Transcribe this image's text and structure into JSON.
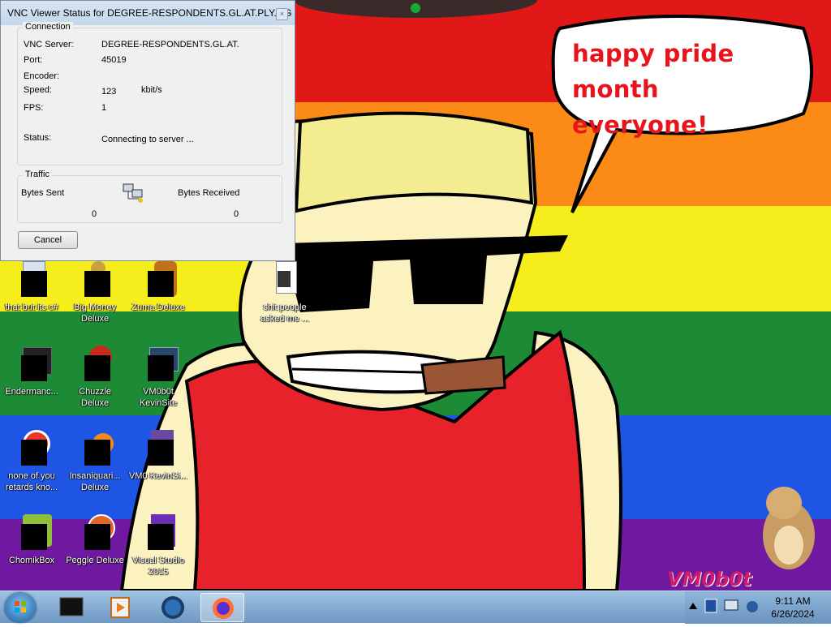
{
  "wallpaper": {
    "bubble_text": "happy pride month everyone!",
    "watermark": "VM0b0t"
  },
  "vnc_dialog": {
    "title": "VNC Viewer Status for DEGREE-RESPONDENTS.GL.AT.PLY.GG",
    "connection_group": "Connection",
    "server_label": "VNC Server:",
    "server_value": "DEGREE-RESPONDENTS.GL.AT.",
    "port_label": "Port:",
    "port_value": "45019",
    "encoder_label": "Encoder:",
    "encoder_value": "",
    "speed_label": "Speed:",
    "speed_value": "123",
    "speed_unit": "kbit/s",
    "fps_label": "FPS:",
    "fps_value": "1",
    "status_label": "Status:",
    "status_value": "Connecting to server ...",
    "traffic_group": "Traffic",
    "bytes_sent_label": "Bytes Sent",
    "bytes_sent_value": "0",
    "bytes_received_label": "Bytes Received",
    "bytes_received_value": "0",
    "cancel_label": "Cancel"
  },
  "desktop_icons": [
    {
      "label": "that but its c#"
    },
    {
      "label": "Big Money Deluxe"
    },
    {
      "label": "Zuma Deluxe"
    },
    {
      "label": "shit people asked me ..."
    },
    {
      "label": "Endermanc..."
    },
    {
      "label": "Chuzzle Deluxe"
    },
    {
      "label": "VM0b0t KevinSite"
    },
    {
      "label": "none of you retards kno..."
    },
    {
      "label": "Insaniquari... Deluxe"
    },
    {
      "label": "VM0 KevinSi..."
    },
    {
      "label": "ChomikBox"
    },
    {
      "label": "Peggle Deluxe"
    },
    {
      "label": "Visual Studio 2015"
    }
  ],
  "taskbar": {
    "time": "9:11 AM",
    "date": "6/26/2024"
  }
}
